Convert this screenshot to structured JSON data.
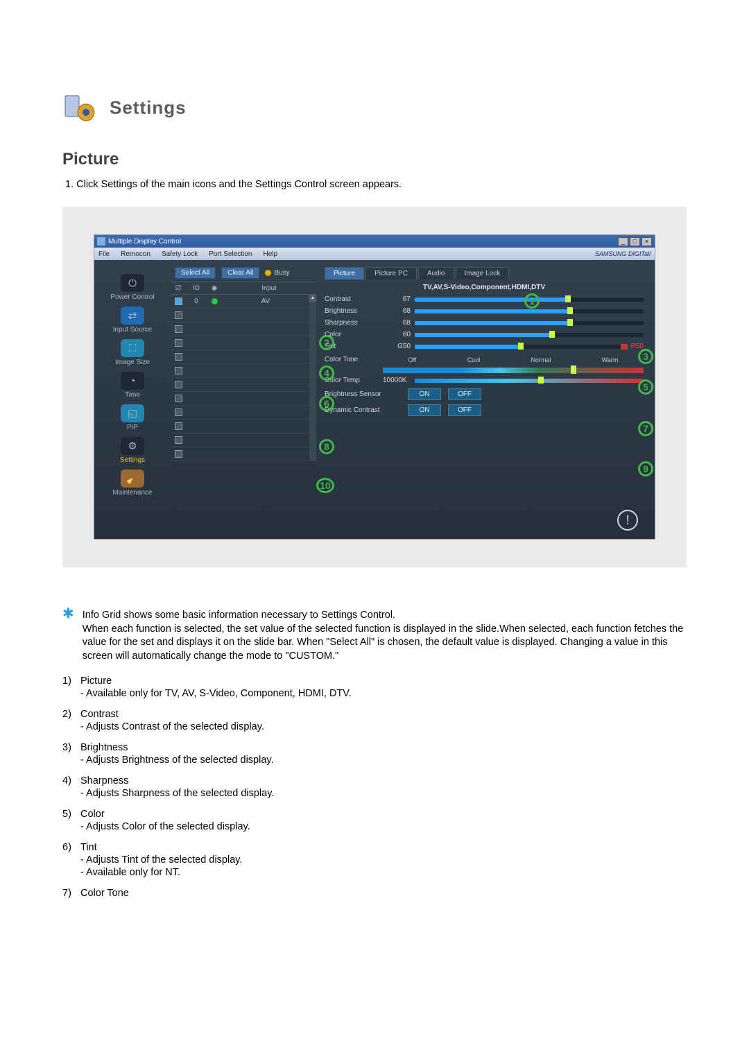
{
  "page": {
    "header_title": "Settings",
    "section_title": "Picture",
    "intro": "1.  Click Settings of the main icons and the Settings Control screen appears."
  },
  "window": {
    "title": "Multiple Display Control",
    "menubar": [
      "File",
      "Remocon",
      "Safety Lock",
      "Port Selection",
      "Help"
    ],
    "brand": "SAMSUNG DIGITall",
    "sidebar": [
      {
        "label": "Power Control"
      },
      {
        "label": "Input Source"
      },
      {
        "label": "Image Size"
      },
      {
        "label": "Time"
      },
      {
        "label": "PIP"
      },
      {
        "label": "Settings",
        "active": true
      },
      {
        "label": "Maintenance"
      }
    ],
    "btn_select_all": "Select All",
    "btn_clear_all": "Clear All",
    "busy": "Busy",
    "grid_headers": {
      "check": "",
      "id": "ID",
      "stat": "",
      "input": "Input"
    },
    "grid_row": {
      "id": "0",
      "input": "AV"
    },
    "tabs": [
      "Picture",
      "Picture PC",
      "Audio",
      "Image Lock"
    ],
    "subheader": "TV,AV,S-Video,Component,HDMI,DTV",
    "params": {
      "contrast": {
        "label": "Contrast",
        "value": "67"
      },
      "brightness": {
        "label": "Brightness",
        "value": "68"
      },
      "sharpness": {
        "label": "Sharpness",
        "value": "68"
      },
      "color": {
        "label": "Color",
        "value": "60"
      },
      "tint": {
        "label": "Tint",
        "left": "G50",
        "right": "R50"
      },
      "color_tone": {
        "label": "Color Tone",
        "options": [
          "Off",
          "Cool",
          "Normal",
          "Warm"
        ]
      },
      "color_temp": {
        "label": "Color Temp",
        "value": "10000K"
      },
      "brightness_sensor": {
        "label": "Brightness Sensor",
        "on": "ON",
        "off": "OFF"
      },
      "dynamic_contrast": {
        "label": "Dynamic Contrast",
        "on": "ON",
        "off": "OFF"
      }
    }
  },
  "callouts": [
    "1",
    "2",
    "3",
    "4",
    "5",
    "6",
    "7",
    "8",
    "9",
    "10"
  ],
  "notes": {
    "star_line1": "Info Grid shows some basic information necessary to Settings Control.",
    "star_line2": "When each function is selected, the set value of the selected function is displayed in the slide.When selected, each function fetches the value for the set and displays it on the slide bar. When \"Select All\" is chosen, the default value is displayed. Changing a value in this screen will automatically change the mode to \"CUSTOM.\""
  },
  "legend": [
    {
      "num": "1)",
      "name": "Picture",
      "desc": [
        "- Available only for TV, AV, S-Video, Component, HDMI, DTV."
      ]
    },
    {
      "num": "2)",
      "name": "Contrast",
      "desc": [
        "- Adjusts Contrast of the selected display."
      ]
    },
    {
      "num": "3)",
      "name": "Brightness",
      "desc": [
        "- Adjusts Brightness of the selected display."
      ]
    },
    {
      "num": "4)",
      "name": "Sharpness",
      "desc": [
        "- Adjusts Sharpness of the selected display."
      ]
    },
    {
      "num": "5)",
      "name": "Color",
      "desc": [
        "- Adjusts Color of the selected display."
      ]
    },
    {
      "num": "6)",
      "name": "Tint",
      "desc": [
        "- Adjusts Tint of the selected display.",
        "- Available  only for NT."
      ]
    },
    {
      "num": "7)",
      "name": "Color Tone",
      "desc": []
    }
  ]
}
